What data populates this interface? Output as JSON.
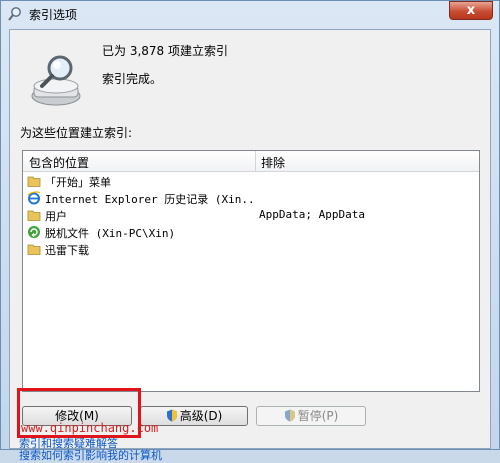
{
  "window": {
    "title": "索引选项",
    "close_label": "x"
  },
  "summary": {
    "count_text": "已为 3,878 项建立索引",
    "status_text": "索引完成。"
  },
  "section_label": "为这些位置建立索引:",
  "list": {
    "headers": [
      "包含的位置",
      "排除"
    ],
    "rows": [
      {
        "name": "「开始」菜单",
        "exclude": "",
        "icon": "folder-icon"
      },
      {
        "name": "Internet Explorer 历史记录 (Xin...",
        "exclude": "",
        "icon": "ie-icon"
      },
      {
        "name": "用户",
        "exclude": "AppData; AppData",
        "icon": "folder-icon"
      },
      {
        "name": "脱机文件 (Xin-PC\\Xin)",
        "exclude": "",
        "icon": "offline-files-icon"
      },
      {
        "name": "迅雷下载",
        "exclude": "",
        "icon": "folder-icon"
      }
    ]
  },
  "buttons": {
    "modify": "修改(M)",
    "advanced": "高级(D)",
    "pause": "暂停(P)"
  },
  "watermark": "www.qinpinchang.com",
  "links": {
    "help1": "索引和搜索疑难解答",
    "help2": "搜索如何索引影响我的计算机"
  },
  "colors": {
    "highlight": "#e0141a",
    "link": "#0a56c5"
  }
}
